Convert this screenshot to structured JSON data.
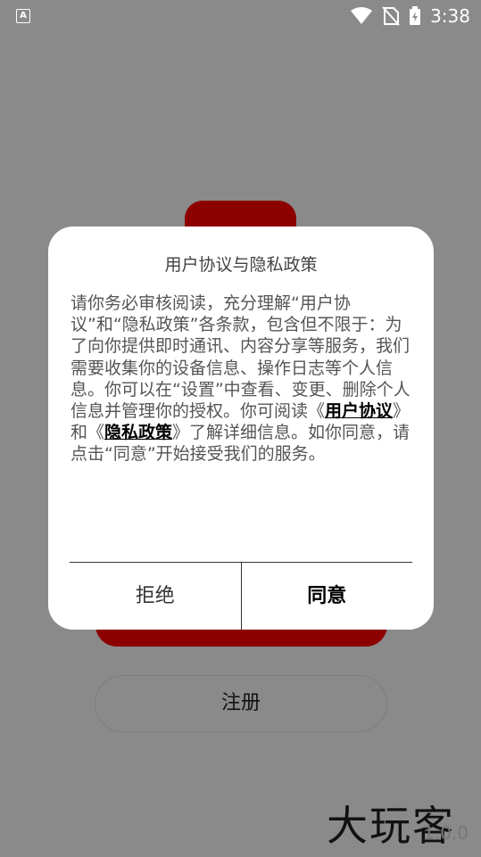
{
  "status_bar": {
    "left_icon_label": "A",
    "time": "3:38",
    "icons": [
      "wifi-icon",
      "no-sim-icon",
      "battery-charging-icon"
    ]
  },
  "background": {
    "register_label": "注册",
    "watermark_text": "大玩客",
    "watermark_sub": "1.0.0"
  },
  "dialog": {
    "title": "用户协议与隐私政策",
    "body_before_links": "请你务必审核阅读，充分理解“用户协议”和“隐私政策”各条款，包含但不限于：为了向你提供即时通讯、内容分享等服务，我们需要收集你的设备信息、操作日志等个人信息。你可以在“设置”中查看、变更、删除个人信息并管理你的授权。你可阅读《",
    "link_user_agreement": "用户协议",
    "body_between_links": "》和《",
    "link_privacy_policy": "隐私政策",
    "body_after_links": "》了解详细信息。如你同意，请点击“同意”开始接受我们的服务。",
    "reject_label": "拒绝",
    "agree_label": "同意"
  },
  "colors": {
    "brand_red": "#8d0000",
    "overlay": "#8a8a8a",
    "dialog_bg": "#ffffff"
  }
}
